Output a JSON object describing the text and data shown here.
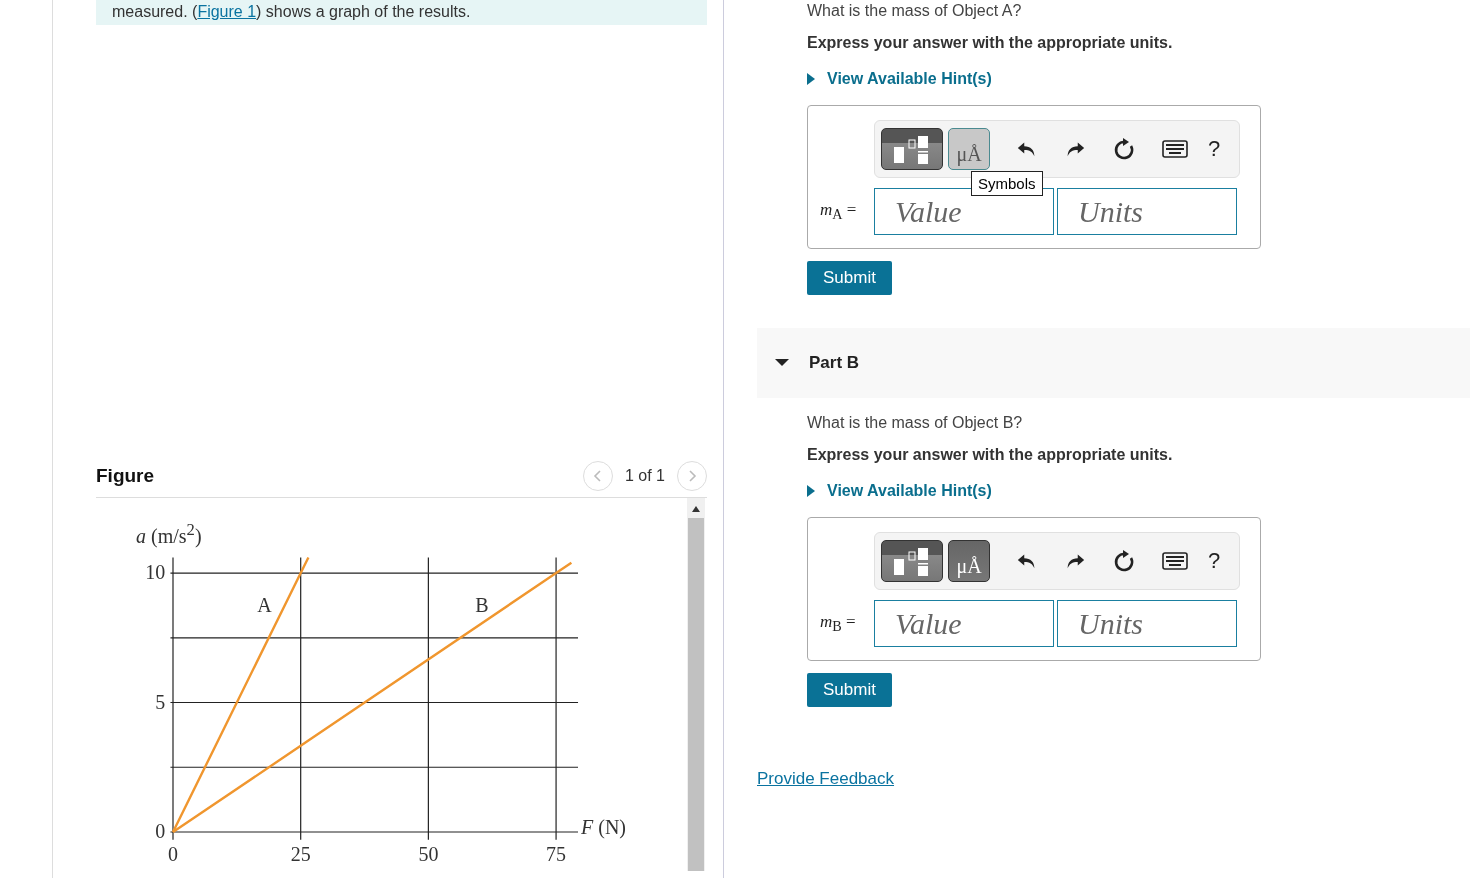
{
  "intro": {
    "before": "measured. (",
    "link": "Figure 1",
    "after": ") shows a graph of the results."
  },
  "figure": {
    "title": "Figure",
    "pager": "1 of 1",
    "chart_data": {
      "type": "line",
      "ylabel": "*a* (m/s$^{2}$)",
      "xlabel": "*F* (N)",
      "x": [
        0,
        25,
        26.5,
        75,
        78
      ],
      "series": [
        {
          "name": "A",
          "color": "#f0962e",
          "values": [
            0,
            10,
            10.6,
            null,
            null
          ]
        },
        {
          "name": "B",
          "color": "#f0962e",
          "values": [
            0,
            3.33,
            3.53,
            10,
            10.4
          ]
        }
      ],
      "xticks": [
        0,
        25,
        50,
        75
      ],
      "yticks": [
        0,
        5,
        10
      ],
      "xlim": [
        0,
        79
      ],
      "ylim": [
        0,
        10.6
      ],
      "grid": true
    }
  },
  "parts": [
    {
      "question": "What is the mass of Object A?",
      "instruction": "Express your answer with the appropriate units.",
      "hint": "View Available Hint(s)",
      "symbols_label": "μÅ",
      "symbols_highlighted": true,
      "tooltip": "Symbols",
      "help": "?",
      "label": "*m*$_{A}$ =",
      "value_placeholder": "Value",
      "units_placeholder": "Units",
      "submit": "Submit"
    },
    {
      "header": "Part B",
      "expanded": true,
      "question": "What is the mass of Object B?",
      "instruction": "Express your answer with the appropriate units.",
      "hint": "View Available Hint(s)",
      "symbols_label": "μÅ",
      "symbols_highlighted": false,
      "help": "?",
      "label": "*m*$_{B}$ =",
      "value_placeholder": "Value",
      "units_placeholder": "Units",
      "submit": "Submit"
    }
  ],
  "feedback": "Provide Feedback"
}
